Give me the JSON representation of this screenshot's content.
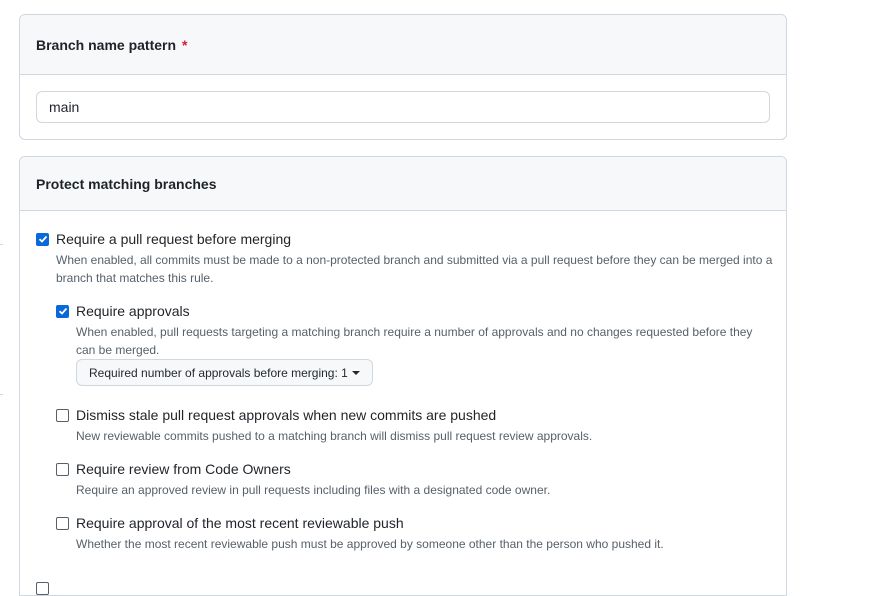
{
  "branch_pattern": {
    "header": "Branch name pattern",
    "required_marker": "*",
    "value": "main"
  },
  "protect": {
    "header": "Protect matching branches",
    "rules": [
      {
        "title": "Require a pull request before merging",
        "description": "When enabled, all commits must be made to a non-protected branch and submitted via a pull request before they can be merged into a branch that matches this rule.",
        "checked": true
      },
      {
        "title": "Require approvals",
        "description": "When enabled, pull requests targeting a matching branch require a number of approvals and no changes requested before they can be merged.",
        "checked": true,
        "dropdown_label": "Required number of approvals before merging: 1"
      },
      {
        "title": "Dismiss stale pull request approvals when new commits are pushed",
        "description": "New reviewable commits pushed to a matching branch will dismiss pull request review approvals.",
        "checked": false
      },
      {
        "title": "Require review from Code Owners",
        "description": "Require an approved review in pull requests including files with a designated code owner.",
        "checked": false
      },
      {
        "title": "Require approval of the most recent reviewable push",
        "description": "Whether the most recent reviewable push must be approved by someone other than the person who pushed it.",
        "checked": false
      }
    ]
  },
  "icons": {
    "checkmark": "check-icon",
    "caret": "caret-down-icon"
  },
  "colors": {
    "accent": "#0969da",
    "border": "#d0d7de",
    "header_bg": "#f6f8fa",
    "required": "#cf222e",
    "muted_text": "#57606a"
  }
}
